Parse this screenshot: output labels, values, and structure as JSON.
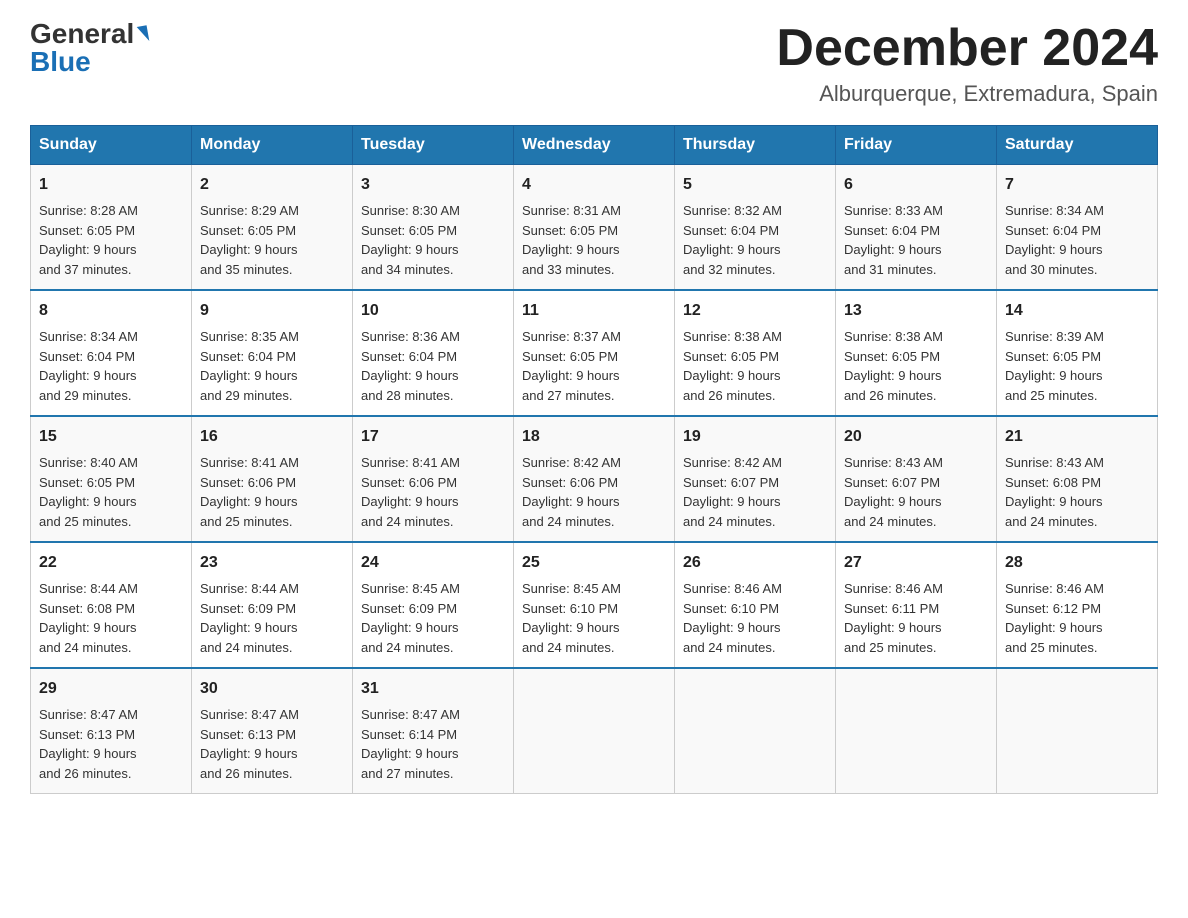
{
  "logo": {
    "general": "General",
    "blue": "Blue"
  },
  "title": "December 2024",
  "location": "Alburquerque, Extremadura, Spain",
  "headers": [
    "Sunday",
    "Monday",
    "Tuesday",
    "Wednesday",
    "Thursday",
    "Friday",
    "Saturday"
  ],
  "weeks": [
    [
      {
        "day": "1",
        "sunrise": "8:28 AM",
        "sunset": "6:05 PM",
        "daylight": "9 hours and 37 minutes."
      },
      {
        "day": "2",
        "sunrise": "8:29 AM",
        "sunset": "6:05 PM",
        "daylight": "9 hours and 35 minutes."
      },
      {
        "day": "3",
        "sunrise": "8:30 AM",
        "sunset": "6:05 PM",
        "daylight": "9 hours and 34 minutes."
      },
      {
        "day": "4",
        "sunrise": "8:31 AM",
        "sunset": "6:05 PM",
        "daylight": "9 hours and 33 minutes."
      },
      {
        "day": "5",
        "sunrise": "8:32 AM",
        "sunset": "6:04 PM",
        "daylight": "9 hours and 32 minutes."
      },
      {
        "day": "6",
        "sunrise": "8:33 AM",
        "sunset": "6:04 PM",
        "daylight": "9 hours and 31 minutes."
      },
      {
        "day": "7",
        "sunrise": "8:34 AM",
        "sunset": "6:04 PM",
        "daylight": "9 hours and 30 minutes."
      }
    ],
    [
      {
        "day": "8",
        "sunrise": "8:34 AM",
        "sunset": "6:04 PM",
        "daylight": "9 hours and 29 minutes."
      },
      {
        "day": "9",
        "sunrise": "8:35 AM",
        "sunset": "6:04 PM",
        "daylight": "9 hours and 29 minutes."
      },
      {
        "day": "10",
        "sunrise": "8:36 AM",
        "sunset": "6:04 PM",
        "daylight": "9 hours and 28 minutes."
      },
      {
        "day": "11",
        "sunrise": "8:37 AM",
        "sunset": "6:05 PM",
        "daylight": "9 hours and 27 minutes."
      },
      {
        "day": "12",
        "sunrise": "8:38 AM",
        "sunset": "6:05 PM",
        "daylight": "9 hours and 26 minutes."
      },
      {
        "day": "13",
        "sunrise": "8:38 AM",
        "sunset": "6:05 PM",
        "daylight": "9 hours and 26 minutes."
      },
      {
        "day": "14",
        "sunrise": "8:39 AM",
        "sunset": "6:05 PM",
        "daylight": "9 hours and 25 minutes."
      }
    ],
    [
      {
        "day": "15",
        "sunrise": "8:40 AM",
        "sunset": "6:05 PM",
        "daylight": "9 hours and 25 minutes."
      },
      {
        "day": "16",
        "sunrise": "8:41 AM",
        "sunset": "6:06 PM",
        "daylight": "9 hours and 25 minutes."
      },
      {
        "day": "17",
        "sunrise": "8:41 AM",
        "sunset": "6:06 PM",
        "daylight": "9 hours and 24 minutes."
      },
      {
        "day": "18",
        "sunrise": "8:42 AM",
        "sunset": "6:06 PM",
        "daylight": "9 hours and 24 minutes."
      },
      {
        "day": "19",
        "sunrise": "8:42 AM",
        "sunset": "6:07 PM",
        "daylight": "9 hours and 24 minutes."
      },
      {
        "day": "20",
        "sunrise": "8:43 AM",
        "sunset": "6:07 PM",
        "daylight": "9 hours and 24 minutes."
      },
      {
        "day": "21",
        "sunrise": "8:43 AM",
        "sunset": "6:08 PM",
        "daylight": "9 hours and 24 minutes."
      }
    ],
    [
      {
        "day": "22",
        "sunrise": "8:44 AM",
        "sunset": "6:08 PM",
        "daylight": "9 hours and 24 minutes."
      },
      {
        "day": "23",
        "sunrise": "8:44 AM",
        "sunset": "6:09 PM",
        "daylight": "9 hours and 24 minutes."
      },
      {
        "day": "24",
        "sunrise": "8:45 AM",
        "sunset": "6:09 PM",
        "daylight": "9 hours and 24 minutes."
      },
      {
        "day": "25",
        "sunrise": "8:45 AM",
        "sunset": "6:10 PM",
        "daylight": "9 hours and 24 minutes."
      },
      {
        "day": "26",
        "sunrise": "8:46 AM",
        "sunset": "6:10 PM",
        "daylight": "9 hours and 24 minutes."
      },
      {
        "day": "27",
        "sunrise": "8:46 AM",
        "sunset": "6:11 PM",
        "daylight": "9 hours and 25 minutes."
      },
      {
        "day": "28",
        "sunrise": "8:46 AM",
        "sunset": "6:12 PM",
        "daylight": "9 hours and 25 minutes."
      }
    ],
    [
      {
        "day": "29",
        "sunrise": "8:47 AM",
        "sunset": "6:13 PM",
        "daylight": "9 hours and 26 minutes."
      },
      {
        "day": "30",
        "sunrise": "8:47 AM",
        "sunset": "6:13 PM",
        "daylight": "9 hours and 26 minutes."
      },
      {
        "day": "31",
        "sunrise": "8:47 AM",
        "sunset": "6:14 PM",
        "daylight": "9 hours and 27 minutes."
      },
      null,
      null,
      null,
      null
    ]
  ],
  "cell_labels": {
    "sunrise": "Sunrise:",
    "sunset": "Sunset:",
    "daylight": "Daylight:"
  }
}
